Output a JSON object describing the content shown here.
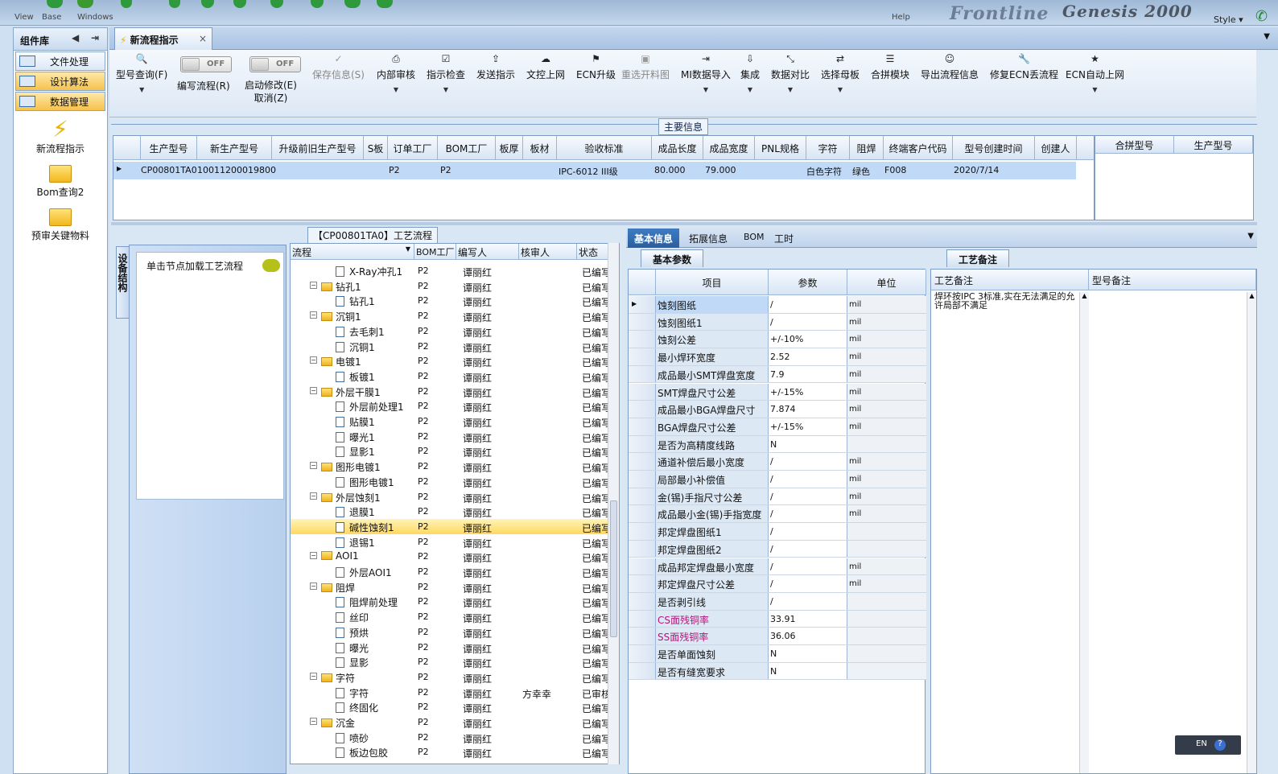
{
  "window": {
    "menu": [
      "View",
      "Base",
      "Windows"
    ],
    "help": "Help",
    "brand": "Frontline",
    "brand2": "Genesis 2000",
    "style_label": "Style"
  },
  "left_panel": {
    "title": "组件库",
    "groups": [
      "文件处理",
      "设计算法",
      "数据管理"
    ],
    "items": [
      "新流程指示",
      "Bom查询2",
      "预审关键物料"
    ]
  },
  "tab": {
    "label": "新流程指示",
    "close": "×"
  },
  "toolbar": {
    "model_query": "型号查询(F)",
    "edit_flow": "编写流程(R)",
    "auto_modify": "启动修改(E)",
    "cancel": "取消(Z)",
    "toggle_off": "OFF",
    "save_info": "保存信息(S)",
    "internal_review": "内部审核",
    "instruction_check": "指示检查",
    "send_instruction": "发送指示",
    "upload_doc": "文控上网",
    "ecn_upgrade": "ECN升级",
    "reselect_drawing": "重选开料图",
    "mi_import": "MI数据导入",
    "integrate": "集成",
    "data_compare": "数据对比",
    "select_master": "选择母板",
    "merge_module": "合拼模块",
    "export_flow": "导出流程信息",
    "repair_ecn": "修复ECN丢流程",
    "ecn_auto_upload": "ECN自动上网"
  },
  "main_info": {
    "title": "主要信息",
    "columns": [
      "生产型号",
      "新生产型号",
      "升级前旧生产型号",
      "S板",
      "订单工厂",
      "BOM工厂",
      "板厚",
      "板材",
      "验收标准",
      "成品长度",
      "成品宽度",
      "PNL规格",
      "字符",
      "阻焊",
      "终端客户代码",
      "型号创建时间",
      "创建人"
    ],
    "row": [
      "CP00801TA0",
      "10011200019800",
      "",
      "",
      "P2",
      "P2",
      "",
      "",
      "IPC-6012 III级",
      "80.000",
      "79.000",
      "",
      "白色字符",
      "绿色",
      "F008",
      "2020/7/14",
      ""
    ],
    "merge_columns": [
      "合拼型号",
      "生产型号"
    ]
  },
  "structure": {
    "vertical_tab": "设备结构",
    "hint": "单击节点加载工艺流程"
  },
  "flow": {
    "title": "【CP00801TA0】工艺流程",
    "columns": [
      "流程",
      "BOM工厂",
      "编写人",
      "核审人",
      "状态"
    ],
    "rows": [
      {
        "name": "X-Ray冲孔1",
        "type": "doc",
        "factory": "P2",
        "writer": "谭丽红",
        "reviewer": "",
        "status": "已编写"
      },
      {
        "name": "钻孔1",
        "type": "folder",
        "factory": "P2",
        "writer": "谭丽红",
        "reviewer": "",
        "status": "已编写"
      },
      {
        "name": "钻孔1",
        "type": "doc",
        "factory": "P2",
        "writer": "谭丽红",
        "reviewer": "",
        "status": "已编写"
      },
      {
        "name": "沉铜1",
        "type": "folder",
        "factory": "P2",
        "writer": "谭丽红",
        "reviewer": "",
        "status": "已编写"
      },
      {
        "name": "去毛刺1",
        "type": "doc",
        "factory": "P2",
        "writer": "谭丽红",
        "reviewer": "",
        "status": "已编写"
      },
      {
        "name": "沉铜1",
        "type": "doc",
        "factory": "P2",
        "writer": "谭丽红",
        "reviewer": "",
        "status": "已编写"
      },
      {
        "name": "电镀1",
        "type": "folder",
        "factory": "P2",
        "writer": "谭丽红",
        "reviewer": "",
        "status": "已编写"
      },
      {
        "name": "板镀1",
        "type": "doc",
        "factory": "P2",
        "writer": "谭丽红",
        "reviewer": "",
        "status": "已编写"
      },
      {
        "name": "外层干膜1",
        "type": "folder",
        "factory": "P2",
        "writer": "谭丽红",
        "reviewer": "",
        "status": "已编写"
      },
      {
        "name": "外层前处理1",
        "type": "doc",
        "factory": "P2",
        "writer": "谭丽红",
        "reviewer": "",
        "status": "已编写"
      },
      {
        "name": "贴膜1",
        "type": "doc",
        "factory": "P2",
        "writer": "谭丽红",
        "reviewer": "",
        "status": "已编写"
      },
      {
        "name": "曝光1",
        "type": "doc",
        "factory": "P2",
        "writer": "谭丽红",
        "reviewer": "",
        "status": "已编写"
      },
      {
        "name": "显影1",
        "type": "doc",
        "factory": "P2",
        "writer": "谭丽红",
        "reviewer": "",
        "status": "已编写"
      },
      {
        "name": "图形电镀1",
        "type": "folder",
        "factory": "P2",
        "writer": "谭丽红",
        "reviewer": "",
        "status": "已编写"
      },
      {
        "name": "图形电镀1",
        "type": "doc",
        "factory": "P2",
        "writer": "谭丽红",
        "reviewer": "",
        "status": "已编写"
      },
      {
        "name": "外层蚀刻1",
        "type": "folder",
        "factory": "P2",
        "writer": "谭丽红",
        "reviewer": "",
        "status": "已编写"
      },
      {
        "name": "退膜1",
        "type": "doc",
        "factory": "P2",
        "writer": "谭丽红",
        "reviewer": "",
        "status": "已编写"
      },
      {
        "name": "碱性蚀刻1",
        "type": "doc",
        "factory": "P2",
        "writer": "谭丽红",
        "reviewer": "",
        "status": "已编写",
        "selected": true
      },
      {
        "name": "退锡1",
        "type": "doc",
        "factory": "P2",
        "writer": "谭丽红",
        "reviewer": "",
        "status": "已编写"
      },
      {
        "name": "AOI1",
        "type": "folder",
        "factory": "P2",
        "writer": "谭丽红",
        "reviewer": "",
        "status": "已编写"
      },
      {
        "name": "外层AOI1",
        "type": "doc",
        "factory": "P2",
        "writer": "谭丽红",
        "reviewer": "",
        "status": "已编写"
      },
      {
        "name": "阻焊",
        "type": "folder",
        "factory": "P2",
        "writer": "谭丽红",
        "reviewer": "",
        "status": "已编写"
      },
      {
        "name": "阻焊前处理",
        "type": "doc",
        "factory": "P2",
        "writer": "谭丽红",
        "reviewer": "",
        "status": "已编写"
      },
      {
        "name": "丝印",
        "type": "doc",
        "factory": "P2",
        "writer": "谭丽红",
        "reviewer": "",
        "status": "已编写"
      },
      {
        "name": "预烘",
        "type": "doc",
        "factory": "P2",
        "writer": "谭丽红",
        "reviewer": "",
        "status": "已编写"
      },
      {
        "name": "曝光",
        "type": "doc",
        "factory": "P2",
        "writer": "谭丽红",
        "reviewer": "",
        "status": "已编写"
      },
      {
        "name": "显影",
        "type": "doc",
        "factory": "P2",
        "writer": "谭丽红",
        "reviewer": "",
        "status": "已编写"
      },
      {
        "name": "字符",
        "type": "folder",
        "factory": "P2",
        "writer": "谭丽红",
        "reviewer": "",
        "status": "已编写"
      },
      {
        "name": "字符",
        "type": "doc",
        "factory": "P2",
        "writer": "谭丽红",
        "reviewer": "方幸幸",
        "status": "已审核"
      },
      {
        "name": "终固化",
        "type": "doc",
        "factory": "P2",
        "writer": "谭丽红",
        "reviewer": "",
        "status": "已编写"
      },
      {
        "name": "沉金",
        "type": "folder",
        "factory": "P2",
        "writer": "谭丽红",
        "reviewer": "",
        "status": "已编写"
      },
      {
        "name": "喷砂",
        "type": "doc",
        "factory": "P2",
        "writer": "谭丽红",
        "reviewer": "",
        "status": "已编写"
      },
      {
        "name": "板边包胶",
        "type": "doc",
        "factory": "P2",
        "writer": "谭丽红",
        "reviewer": "",
        "status": "已编写"
      }
    ]
  },
  "right_tabs": [
    "基本信息",
    "拓展信息",
    "BOM",
    "工时"
  ],
  "params": {
    "subtab": "基本参数",
    "columns": [
      "项目",
      "参数",
      "单位"
    ],
    "rows": [
      {
        "k": "蚀刻图纸",
        "v": "/",
        "u": "mil"
      },
      {
        "k": "蚀刻图纸1",
        "v": "/",
        "u": "mil"
      },
      {
        "k": "蚀刻公差",
        "v": "+/-10%",
        "u": "mil"
      },
      {
        "k": "最小焊环宽度",
        "v": "2.52",
        "u": "mil"
      },
      {
        "k": "成品最小SMT焊盘宽度",
        "v": "7.9",
        "u": "mil"
      },
      {
        "k": "SMT焊盘尺寸公差",
        "v": "+/-15%",
        "u": "mil"
      },
      {
        "k": "成品最小BGA焊盘尺寸",
        "v": "7.874",
        "u": "mil"
      },
      {
        "k": "BGA焊盘尺寸公差",
        "v": "+/-15%",
        "u": "mil"
      },
      {
        "k": "是否为高精度线路",
        "v": "N",
        "u": ""
      },
      {
        "k": "通道补偿后最小宽度",
        "v": "/",
        "u": "mil"
      },
      {
        "k": "局部最小补偿值",
        "v": "/",
        "u": "mil"
      },
      {
        "k": "金(锡)手指尺寸公差",
        "v": "/",
        "u": "mil"
      },
      {
        "k": "成品最小金(锡)手指宽度",
        "v": "/",
        "u": "mil"
      },
      {
        "k": "邦定焊盘图纸1",
        "v": "/",
        "u": ""
      },
      {
        "k": "邦定焊盘图纸2",
        "v": "/",
        "u": ""
      },
      {
        "k": "成品邦定焊盘最小宽度",
        "v": "/",
        "u": "mil"
      },
      {
        "k": "邦定焊盘尺寸公差",
        "v": "/",
        "u": "mil"
      },
      {
        "k": "是否剥引线",
        "v": "/",
        "u": ""
      },
      {
        "k": "CS面残铜率",
        "v": "33.91",
        "u": "",
        "pink": true
      },
      {
        "k": "SS面残铜率",
        "v": "36.06",
        "u": "",
        "pink": true
      },
      {
        "k": "是否单面蚀刻",
        "v": "N",
        "u": ""
      },
      {
        "k": "是否有缝宽要求",
        "v": "N",
        "u": ""
      }
    ]
  },
  "notes": {
    "subtab": "工艺备注",
    "col1": "工艺备注",
    "col2": "型号备注",
    "text": "焊环按IPC 3标准,实在无法满足的允许局部不满足"
  },
  "ime": {
    "label": "EN"
  }
}
